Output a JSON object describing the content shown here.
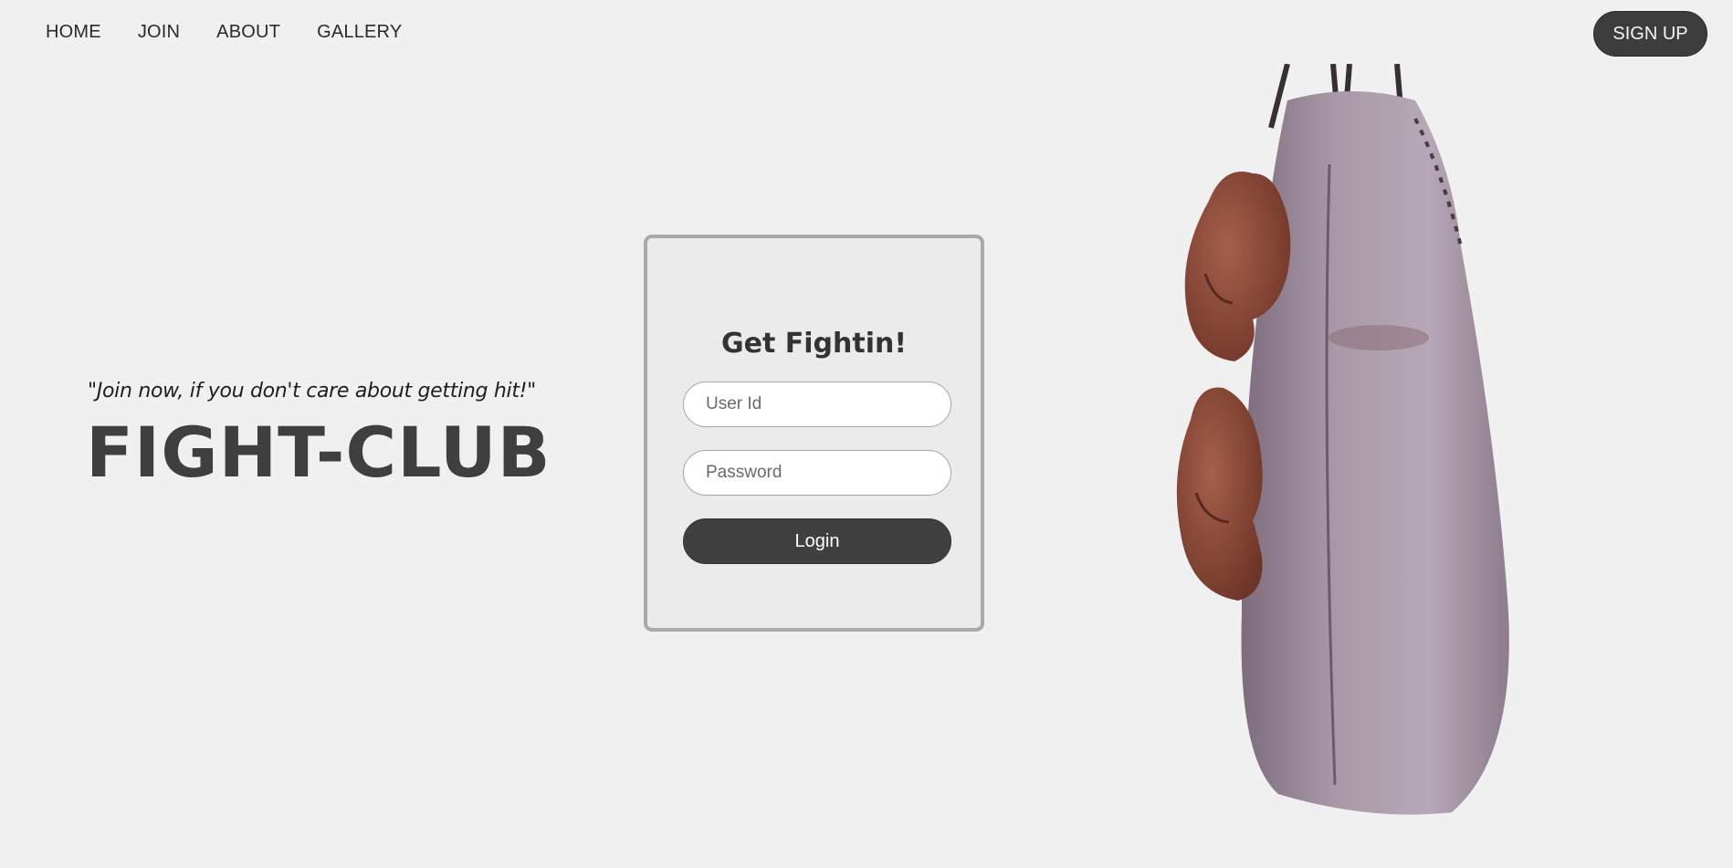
{
  "nav": {
    "items": [
      "HOME",
      "JOIN",
      "ABOUT",
      "GALLERY"
    ],
    "signup_label": "SIGN UP"
  },
  "hero": {
    "tagline": "\"Join now, if you don't care about getting hit!\"",
    "brand": "FIGHT-CLUB"
  },
  "login": {
    "title": "Get Fightin!",
    "user_placeholder": "User Id",
    "user_value": "",
    "password_placeholder": "Password",
    "password_value": "",
    "button_label": "Login"
  },
  "colors": {
    "background": "#f0f0f0",
    "button_dark": "#404040",
    "card_border": "#a9a9a9",
    "glove_brown": "#8a4a3a",
    "bag_purple": "#9a8a99"
  },
  "images": {
    "hero_image": "punching-bag-with-boxing-gloves"
  }
}
